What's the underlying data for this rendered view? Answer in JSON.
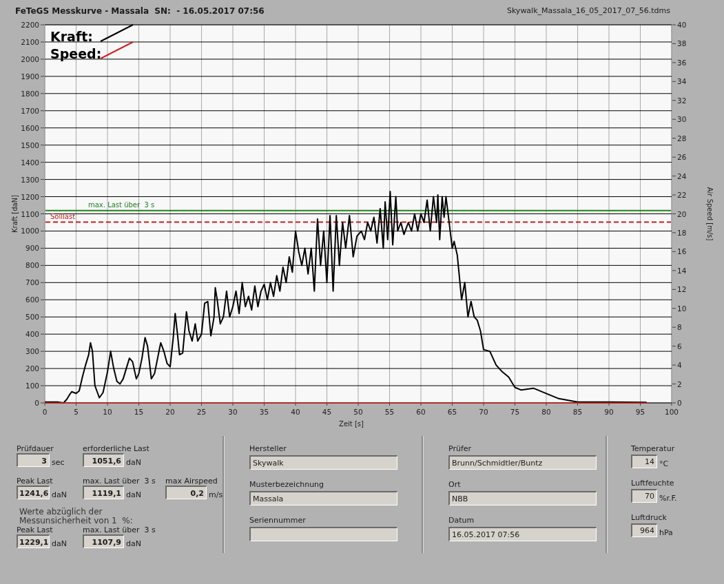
{
  "header": {
    "title": "FeTeGS Messkurve - Massala  SN:  - 16.05.2017 07:56",
    "file_name": "Skywalk_Massala_16_05_2017_07_56.tdms"
  },
  "chart": {
    "chart_data": {
      "type": "line",
      "xlabel": "Zeit [s]",
      "ylabel": "Kraft [daN]",
      "y2label": "Air Speed [m/s]",
      "xlim": [
        0,
        100
      ],
      "ylim": [
        0,
        2200
      ],
      "y2lim": [
        0,
        40
      ],
      "xticks": [
        0,
        5,
        10,
        15,
        20,
        25,
        30,
        35,
        40,
        45,
        50,
        55,
        60,
        65,
        70,
        75,
        80,
        85,
        90,
        95,
        100
      ],
      "yticks": [
        0,
        100,
        200,
        300,
        400,
        500,
        600,
        700,
        800,
        900,
        1000,
        1100,
        1200,
        1300,
        1400,
        1500,
        1600,
        1700,
        1800,
        1900,
        2000,
        2100,
        2200
      ],
      "y2ticks": [
        0,
        2,
        4,
        6,
        8,
        10,
        12,
        14,
        16,
        18,
        20,
        22,
        24,
        26,
        28,
        30,
        32,
        34,
        36,
        38,
        40
      ],
      "x": [
        0,
        1,
        2,
        3,
        3.5,
        4,
        4.3,
        5,
        5.5,
        6,
        6.5,
        7,
        7.3,
        7.6,
        8,
        8.7,
        9.3,
        10,
        10.5,
        11,
        11.5,
        12,
        12.5,
        13,
        13.5,
        14,
        14.6,
        15,
        15.5,
        16,
        16.4,
        17,
        17.5,
        18,
        18.5,
        19,
        19.5,
        20,
        20.5,
        20.8,
        21.2,
        21.5,
        22,
        22.6,
        23,
        23.5,
        24,
        24.4,
        25,
        25.5,
        26,
        26.5,
        27,
        27.2,
        27.5,
        28,
        28.5,
        29,
        29.5,
        30,
        30.5,
        31,
        31.5,
        32,
        32.5,
        33,
        33.5,
        34,
        34.5,
        35,
        35.5,
        36,
        36.5,
        37,
        37.5,
        38,
        38.5,
        39,
        39.5,
        40,
        40.5,
        41,
        41.5,
        42,
        42.5,
        43,
        43.5,
        44,
        44.5,
        45,
        45.5,
        46,
        46.5,
        47,
        47.5,
        48,
        48.6,
        49.2,
        49.8,
        50.5,
        51,
        51.5,
        52,
        52.5,
        53,
        53.5,
        54,
        54.3,
        54.7,
        55.1,
        55.5,
        56,
        56.3,
        56.8,
        57.3,
        58,
        58.5,
        59,
        59.5,
        60,
        60.5,
        61,
        61.5,
        62,
        62.5,
        62.7,
        63,
        63.4,
        63.7,
        64,
        64.5,
        65,
        65.3,
        65.8,
        66.5,
        67,
        67.5,
        68,
        68.5,
        69,
        69.5,
        70,
        71,
        72,
        73,
        74,
        75,
        76,
        78,
        80,
        82,
        85,
        90,
        96
      ],
      "series": [
        {
          "name": "Kraft:",
          "color": "#000000",
          "values": [
            5,
            5,
            5,
            0,
            20,
            50,
            65,
            55,
            70,
            150,
            220,
            280,
            350,
            300,
            100,
            30,
            60,
            180,
            300,
            200,
            125,
            110,
            140,
            200,
            260,
            240,
            140,
            170,
            260,
            380,
            330,
            140,
            170,
            260,
            350,
            300,
            230,
            210,
            380,
            520,
            390,
            280,
            290,
            530,
            420,
            360,
            460,
            360,
            400,
            580,
            590,
            390,
            500,
            670,
            600,
            460,
            500,
            650,
            500,
            560,
            650,
            520,
            700,
            560,
            620,
            540,
            680,
            560,
            650,
            690,
            600,
            700,
            620,
            740,
            650,
            790,
            700,
            850,
            760,
            1000,
            880,
            800,
            900,
            750,
            900,
            650,
            1070,
            800,
            1000,
            700,
            1090,
            650,
            1090,
            800,
            1050,
            900,
            1090,
            850,
            970,
            1000,
            950,
            1050,
            1000,
            1080,
            930,
            1130,
            900,
            1170,
            950,
            1230,
            920,
            1200,
            1000,
            1050,
            980,
            1050,
            1000,
            1100,
            1000,
            1100,
            1050,
            1180,
            1000,
            1200,
            1050,
            1210,
            950,
            1200,
            1080,
            1200,
            1050,
            900,
            940,
            860,
            600,
            700,
            500,
            590,
            500,
            480,
            420,
            310,
            300,
            220,
            180,
            150,
            90,
            75,
            85,
            55,
            25,
            5,
            5,
            3
          ]
        },
        {
          "name": "Speed:",
          "color": "#d02020",
          "axis": "y2",
          "values": [
            0,
            0,
            0,
            0,
            0,
            0,
            0,
            0,
            0,
            0,
            0,
            0,
            0,
            0,
            0,
            0,
            0,
            0,
            0,
            0,
            0,
            0,
            0,
            0,
            0,
            0,
            0,
            0,
            0,
            0,
            0,
            0,
            0,
            0,
            0,
            0,
            0,
            0,
            0,
            0,
            0,
            0,
            0,
            0,
            0,
            0,
            0,
            0,
            0,
            0,
            0,
            0,
            0,
            0,
            0,
            0,
            0,
            0,
            0,
            0,
            0,
            0,
            0,
            0,
            0,
            0,
            0,
            0,
            0,
            0,
            0,
            0,
            0,
            0,
            0,
            0,
            0,
            0,
            0,
            0,
            0,
            0,
            0,
            0,
            0,
            0,
            0,
            0,
            0,
            0,
            0,
            0,
            0,
            0,
            0,
            0,
            0,
            0,
            0,
            0,
            0,
            0,
            0,
            0,
            0,
            0,
            0,
            0,
            0,
            0,
            0,
            0,
            0,
            0,
            0,
            0,
            0,
            0,
            0,
            0,
            0,
            0,
            0,
            0,
            0,
            0,
            0,
            0,
            0,
            0,
            0,
            0,
            0,
            0,
            0,
            0,
            0,
            0,
            0,
            0,
            0,
            0,
            0,
            0,
            0,
            0,
            0,
            0,
            0,
            0,
            0,
            0,
            0,
            0
          ]
        }
      ],
      "ref_lines": [
        {
          "axis": "y",
          "value": 1119.1,
          "label": "max. Last über  3 s",
          "color": "#208020"
        },
        {
          "axis": "y",
          "value": 1051.6,
          "label": "Solllast",
          "color": "#c02020"
        }
      ],
      "grid": true,
      "legend": "upper left"
    }
  },
  "results": {
    "rows": [
      [
        {
          "label": "Prüfdauer",
          "value": "3",
          "unit": "sec"
        },
        {
          "label": "erforderliche Last",
          "value": "1051,6",
          "unit": "daN"
        }
      ],
      [
        {
          "label": "Peak Last",
          "value": "1241,6",
          "unit": "daN"
        },
        {
          "label": "max. Last über  3 s",
          "value": "1119,1",
          "unit": "daN"
        },
        {
          "label": "max Airspeed",
          "value": "0,2",
          "unit": "m/s"
        }
      ]
    ],
    "note": "Werte abzüglich der\nMessunsicherheit von 1  %:",
    "corrected": [
      {
        "label": "Peak Last",
        "value": "1229,1",
        "unit": "daN"
      },
      {
        "label": "max. Last über  3 s",
        "value": "1107,9",
        "unit": "daN"
      }
    ]
  },
  "product": [
    {
      "label": "Hersteller",
      "value": "Skywalk"
    },
    {
      "label": "Musterbezeichnung",
      "value": "Massala"
    },
    {
      "label": "Seriennummer"
    }
  ],
  "test": [
    {
      "label": "Prüfer",
      "value": "Brunn/Schmidtler/Buntz"
    },
    {
      "label": "Ort",
      "value": "NBB"
    },
    {
      "label": "Datum",
      "value": "16.05.2017 07:56"
    }
  ],
  "conditions": [
    {
      "label": "Temperatur",
      "value": "14",
      "unit": "°C"
    },
    {
      "label": "Luftfeuchte",
      "value": "70",
      "unit": "%r.F."
    },
    {
      "label": "Luftdruck",
      "value": "964",
      "unit": "hPa"
    }
  ]
}
